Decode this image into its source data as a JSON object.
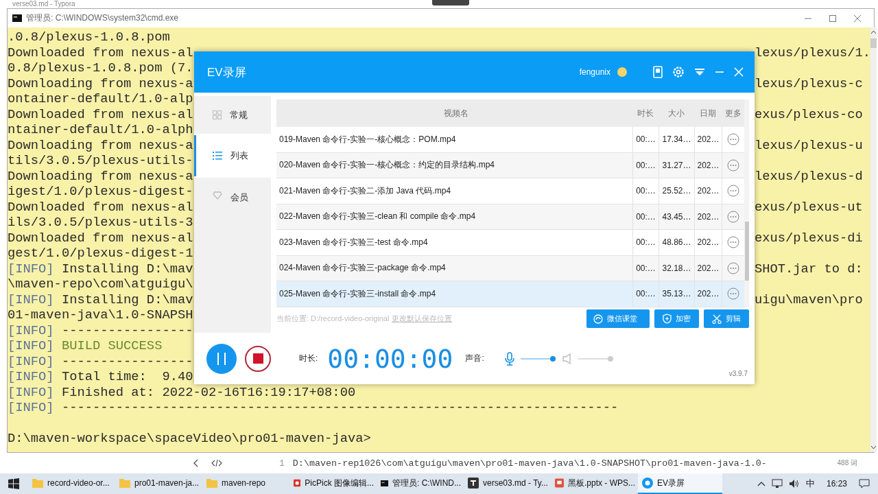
{
  "typora": {
    "title": "verse03.md - Typora",
    "line_number": "1",
    "editor_line": "D:\\maven-rep1026\\com\\atguigu\\maven\\pro01-maven-java\\1.0-SNAPSHOT\\pro01-maven-java-1.0-",
    "word_count": "488 词"
  },
  "cmd": {
    "title": "管理员: C:\\WINDOWS\\system32\\cmd.exe",
    "lines": [
      {
        "text": ".0.8/plexus-1.0.8.pom"
      },
      {
        "text": "Downloaded from nexus-al",
        "right": "lexus/plexus/1."
      },
      {
        "text": "0.8/plexus-1.0.8.pom (7."
      },
      {
        "text": "Downloading from nexus-a",
        "right": "lexus/plexus-c"
      },
      {
        "text": "ontainer-default/1.0-alp"
      },
      {
        "text": "Downloaded from nexus-al",
        "right": "exus/plexus-co"
      },
      {
        "text": "ntainer-default/1.0-alph"
      },
      {
        "text": "Downloading from nexus-a",
        "right": "lexus/plexus-u"
      },
      {
        "text": "tils/3.0.5/plexus-utils-"
      },
      {
        "text": "Downloading from nexus-a",
        "right": "lexus/plexus-d"
      },
      {
        "text": "igest/1.0/plexus-digest-"
      },
      {
        "text": "Downloaded from nexus-al",
        "right": "exus/plexus-ut"
      },
      {
        "text": "ils/3.0.5/plexus-utils-3"
      },
      {
        "text": "Downloaded from nexus-al",
        "right": "exus/plexus-di"
      },
      {
        "text": "gest/1.0/plexus-digest-1"
      },
      {
        "tag": "[INFO]",
        "text": " Installing D:\\mav",
        "right": "SHOT.jar to d:"
      },
      {
        "text": "\\maven-repo\\com\\atguigu\\"
      },
      {
        "tag": "[INFO]",
        "text": " Installing D:\\mav",
        "right": "uigu\\maven\\pro"
      },
      {
        "text": "01-maven-java\\1.0-SNAPSH"
      },
      {
        "tag": "[INFO]",
        "text": " -----------------"
      },
      {
        "tag": "[INFO]",
        "text": " BUILD SUCCESS",
        "kind": "success"
      },
      {
        "tag": "[INFO]",
        "text": " -----------------"
      },
      {
        "tag": "[INFO]",
        "text": " Total time:  9.40"
      },
      {
        "tag": "[INFO]",
        "text": " Finished at: 2022-02-16T16:19:17+08:00"
      },
      {
        "tag": "[INFO]",
        "text": " ------------------------------------------------------------------------"
      },
      {
        "text": "D:\\maven-workspace\\spaceVideo\\pro01-maven-java>",
        "kind": "prompt"
      }
    ]
  },
  "ev": {
    "title": "EV录屏",
    "user": "fengunix",
    "nav": [
      {
        "label": "常规",
        "selected": false
      },
      {
        "label": "列表",
        "selected": true
      },
      {
        "label": "会员",
        "selected": false
      }
    ],
    "table": {
      "columns": [
        "视频名",
        "时长",
        "大小",
        "日期",
        "更多"
      ],
      "rows": [
        {
          "name": "019-Maven 命令行-实验一-核心概念：POM.mp4",
          "duration": "00:…",
          "size": "17.34…",
          "date": "202…",
          "selected": false
        },
        {
          "name": "020-Maven 命令行-实验一-核心概念：约定的目录结构.mp4",
          "duration": "00:…",
          "size": "31.27…",
          "date": "202…",
          "selected": false
        },
        {
          "name": "021-Maven 命令行-实验二-添加 Java 代码.mp4",
          "duration": "00:…",
          "size": "25.52…",
          "date": "202…",
          "selected": false
        },
        {
          "name": "022-Maven 命令行-实验三-clean 和 compile 命令.mp4",
          "duration": "00:…",
          "size": "43.45…",
          "date": "202…",
          "selected": false
        },
        {
          "name": "023-Maven 命令行-实验三-test 命令.mp4",
          "duration": "00:…",
          "size": "48.86…",
          "date": "202…",
          "selected": false
        },
        {
          "name": "024-Maven 命令行-实验三-package 命令.mp4",
          "duration": "00:…",
          "size": "32.18…",
          "date": "202…",
          "selected": false
        },
        {
          "name": "025-Maven 命令行-实验三-install 命令.mp4",
          "duration": "00:…",
          "size": "35.13…",
          "date": "202…",
          "selected": true
        }
      ]
    },
    "location": "当前位置: D:/record-video-original",
    "location_link": "更改默认保存位置",
    "actions": [
      {
        "label": "微信课堂",
        "kind": "wechat"
      },
      {
        "label": "加密",
        "kind": "shield"
      },
      {
        "label": "剪辑",
        "kind": "scissors"
      }
    ],
    "duration_label": "时长:",
    "timer": "00:00:00",
    "sound_label": "声音:",
    "mic": {
      "on": true,
      "level": 1
    },
    "speaker": {
      "on": false,
      "level": 1
    },
    "version": "v3.9.7"
  },
  "taskbar": {
    "items": [
      {
        "label": "record-video-or...",
        "kind": "folder",
        "selected": false
      },
      {
        "label": "pro01-maven-ja...",
        "kind": "folder",
        "selected": false
      },
      {
        "label": "maven-repo",
        "kind": "folder",
        "selected": false
      },
      {
        "label": "PicPick 图像编辑...",
        "kind": "picpick",
        "selected": false
      },
      {
        "label": "管理员: C:\\WIND...",
        "kind": "console",
        "selected": false
      },
      {
        "label": "verse03.md - Ty...",
        "kind": "typora",
        "selected": false
      },
      {
        "label": "黑板.pptx - WPS...",
        "kind": "slides",
        "selected": false
      },
      {
        "label": "EV录屏",
        "kind": "recorder",
        "selected": true
      }
    ],
    "ime": "中",
    "time": "16:23"
  }
}
